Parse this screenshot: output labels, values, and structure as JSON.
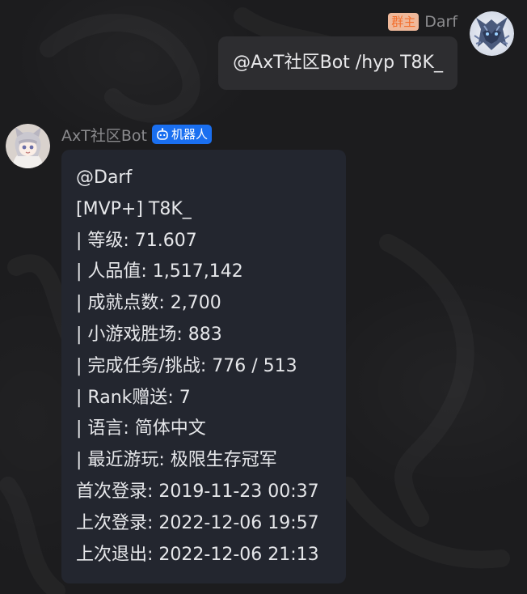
{
  "outgoing": {
    "sender": "Darf",
    "role": "群主",
    "text": "@AxT社区Bot /hyp T8K_",
    "avatar_icon": "wolf-avatar"
  },
  "incoming": {
    "sender": "AxT社区Bot",
    "badge": "机器人",
    "avatar_icon": "catgirl-avatar",
    "lines": [
      "@Darf",
      "[MVP+] T8K_",
      "| 等级: 71.607",
      "| 人品值: 1,517,142",
      "| 成就点数: 2,700",
      "| 小游戏胜场: 883",
      "| 完成任务/挑战: 776 / 513",
      "| Rank赠送: 7",
      "| 语言: 简体中文",
      "| 最近游玩: 极限生存冠军",
      "首次登录: 2019-11-23 00:37",
      "上次登录: 2022-12-06 19:57",
      "上次退出: 2022-12-06 21:13"
    ]
  },
  "colors": {
    "background": "#1c1c1e",
    "bubble_out": "#2d2d30",
    "bubble_in": "#23262f",
    "bot_badge": "#1a6ff0",
    "role_badge_bg": "#efb89a",
    "role_badge_text": "#f36e2c"
  }
}
